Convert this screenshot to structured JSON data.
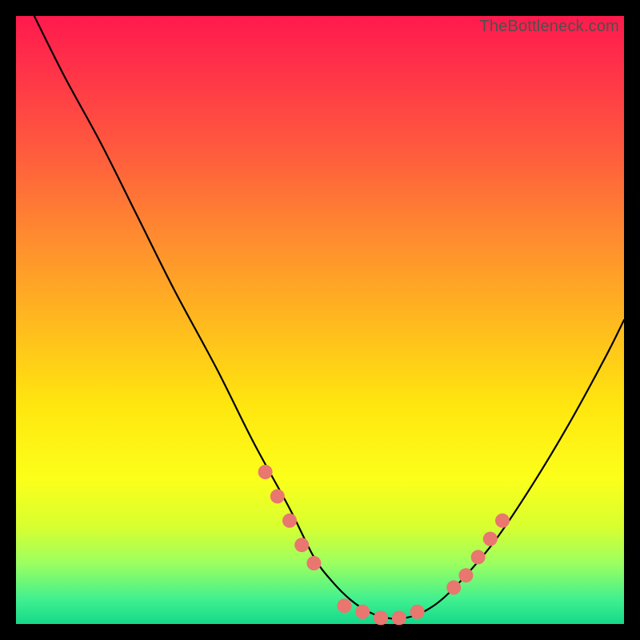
{
  "attribution": "TheBottleneck.com",
  "chart_data": {
    "type": "line",
    "title": "",
    "xlabel": "",
    "ylabel": "",
    "xlim": [
      0,
      100
    ],
    "ylim": [
      0,
      100
    ],
    "series": [
      {
        "name": "bottleneck-curve",
        "x": [
          3,
          8,
          14,
          20,
          26,
          33,
          39,
          45,
          49,
          52,
          55,
          58,
          61,
          64,
          67,
          70,
          74,
          79,
          85,
          91,
          97,
          100
        ],
        "values": [
          100,
          90,
          79,
          67,
          55,
          42,
          30,
          19,
          11,
          7,
          4,
          2,
          1,
          1,
          2,
          4,
          8,
          14,
          23,
          33,
          44,
          50
        ]
      }
    ],
    "markers": {
      "name": "highlight-points",
      "x": [
        41,
        43,
        45,
        47,
        49,
        54,
        57,
        60,
        63,
        66,
        72,
        74,
        76,
        78,
        80
      ],
      "values": [
        25,
        21,
        17,
        13,
        10,
        3,
        2,
        1,
        1,
        2,
        6,
        8,
        11,
        14,
        17
      ],
      "color": "#e9766f",
      "radius": 9
    }
  }
}
